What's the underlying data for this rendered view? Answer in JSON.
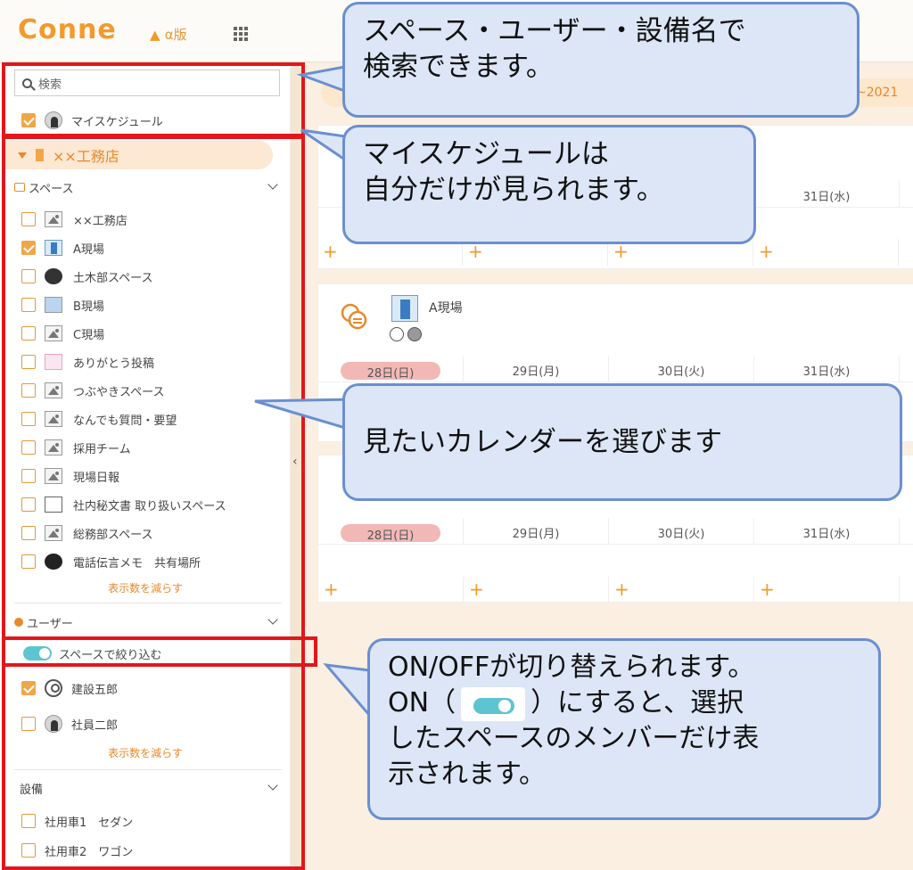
{
  "header": {
    "logo": "Conne",
    "alpha_label": "α版"
  },
  "sidebar": {
    "search_placeholder": "検索",
    "my_schedule_label": "マイスケジュール",
    "group_name": "××工務店",
    "spaces_header": "スペース",
    "spaces": [
      {
        "label": "××工務店",
        "checked": false,
        "icon": "image-icon"
      },
      {
        "label": "A現場",
        "checked": true,
        "icon": "building-icon"
      },
      {
        "label": "土木部スペース",
        "checked": false,
        "icon": "helmet-icon"
      },
      {
        "label": "B現場",
        "checked": false,
        "icon": "map-icon"
      },
      {
        "label": "C現場",
        "checked": false,
        "icon": "image-icon"
      },
      {
        "label": "ありがとう投稿",
        "checked": false,
        "icon": "gift-icon"
      },
      {
        "label": "つぶやきスペース",
        "checked": false,
        "icon": "image-icon"
      },
      {
        "label": "なんでも質問・要望",
        "checked": false,
        "icon": "image-icon"
      },
      {
        "label": "採用チーム",
        "checked": false,
        "icon": "image-icon"
      },
      {
        "label": "現場日報",
        "checked": false,
        "icon": "image-icon"
      },
      {
        "label": "社内秘文書 取り扱いスペース",
        "checked": false,
        "icon": "lock-icon"
      },
      {
        "label": "総務部スペース",
        "checked": false,
        "icon": "image-icon"
      },
      {
        "label": "電話伝言メモ　共有場所",
        "checked": false,
        "icon": "phone-icon"
      }
    ],
    "show_less_label": "表示数を減らす",
    "users_header": "ユーザー",
    "filter_toggle_label": "スペースで絞り込む",
    "users": [
      {
        "label": "建設五郎",
        "checked": true
      },
      {
        "label": "社員二郎",
        "checked": false
      }
    ],
    "users_show_less_label": "表示数を減らす",
    "equipment_header": "設備",
    "equipment": [
      {
        "label": "社用車1　セダン",
        "checked": false
      },
      {
        "label": "社用車2　ワゴン",
        "checked": false
      }
    ]
  },
  "main": {
    "date_range_fragment": "~2021",
    "cards": [
      {
        "name": "",
        "days": [
          "",
          "",
          "",
          "31日(水)"
        ]
      },
      {
        "name": "A現場",
        "days": [
          "28日(日)",
          "29日(月)",
          "30日(火)",
          "31日(水)"
        ]
      },
      {
        "name": "",
        "days": [
          "28日(日)",
          "29日(月)",
          "30日(火)",
          "31日(水)"
        ]
      }
    ]
  },
  "callouts": {
    "search": "スペース・ユーザー・設備名で\n検索できます。",
    "my_schedule": "マイスケジュールは\n自分だけが見られます。",
    "choose": "見たいカレンダーを選びます",
    "toggle_line1": "ON/OFFが切り替えられます。",
    "toggle_line2_a": "ON（",
    "toggle_line2_b": "）にすると、選択",
    "toggle_line3": "したスペースのメンバーだけ表\n示されます。"
  },
  "colors": {
    "accent": "#f39a2b",
    "highlight": "#e3161b",
    "callout_bg": "#dce6f6",
    "callout_border": "#6a8fd0",
    "toggle": "#5cc5cf"
  }
}
